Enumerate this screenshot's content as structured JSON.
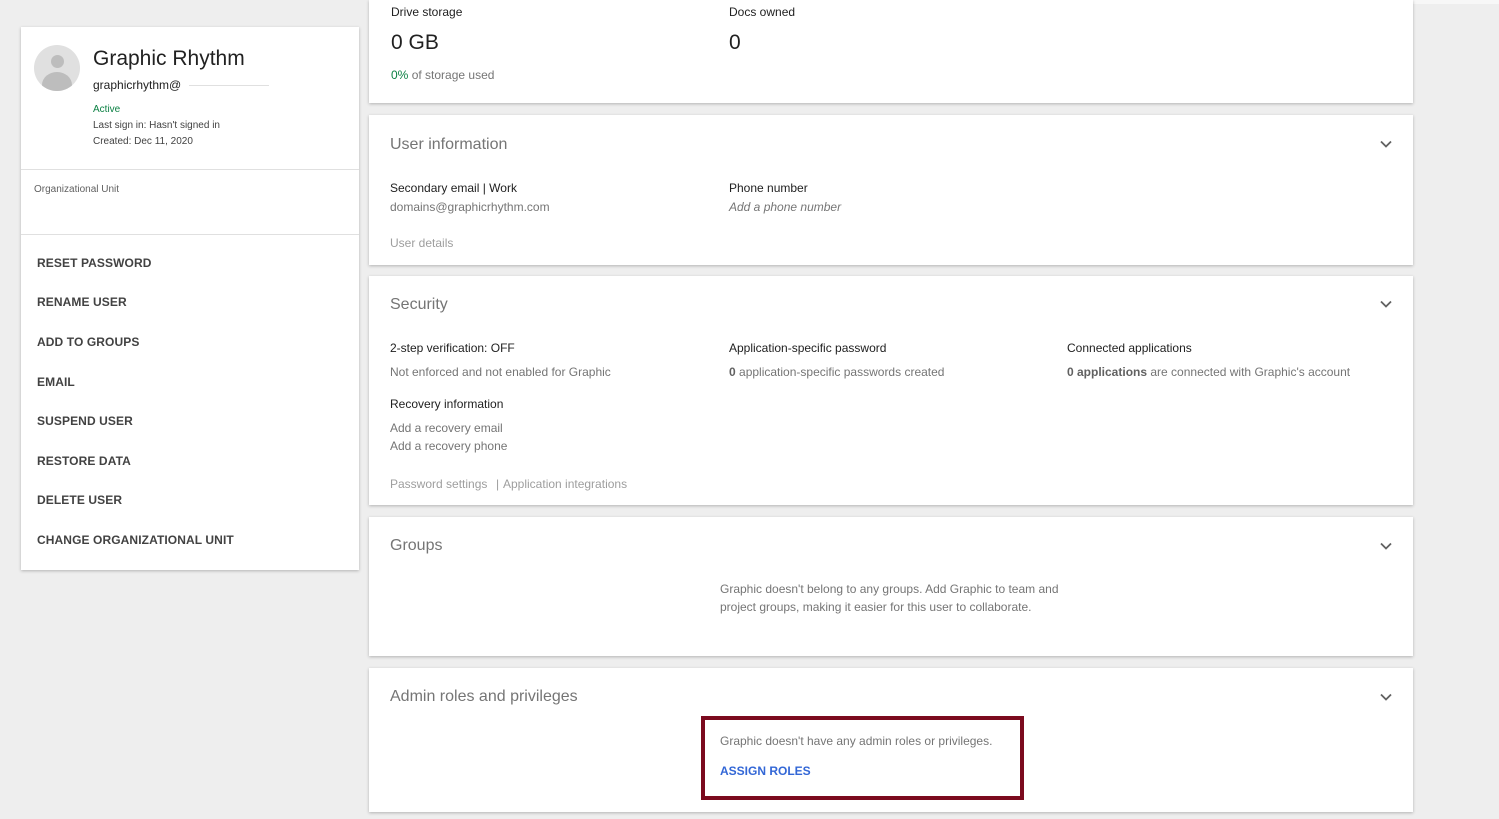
{
  "profile": {
    "name": "Graphic Rhythm",
    "email": "graphicrhythm@",
    "status": "Active",
    "last_sign_in": "Last sign in: Hasn't signed in",
    "created": "Created: Dec 11, 2020",
    "ou_label": "Organizational Unit"
  },
  "actions": [
    "RESET PASSWORD",
    "RENAME USER",
    "ADD TO GROUPS",
    "EMAIL",
    "SUSPEND USER",
    "RESTORE DATA",
    "DELETE USER",
    "CHANGE ORGANIZATIONAL UNIT"
  ],
  "storage": {
    "drive_label": "Drive storage",
    "drive_value": "0 GB",
    "used_pct": "0%",
    "used_suffix": "of storage used",
    "docs_label": "Docs owned",
    "docs_value": "0"
  },
  "user_info": {
    "title": "User information",
    "secondary_label": "Secondary email | Work",
    "secondary_value": "domains@graphicrhythm.com",
    "phone_label": "Phone number",
    "phone_placeholder": "Add a phone number",
    "details_link": "User details"
  },
  "security": {
    "title": "Security",
    "two_step_label": "2-step verification:",
    "two_step_value": "OFF",
    "two_step_desc": "Not enforced and not enabled for Graphic",
    "app_pw_label": "Application-specific password",
    "app_pw_count": "0",
    "app_pw_desc": "application-specific passwords created",
    "connected_label": "Connected applications",
    "connected_count": "0 applications",
    "connected_desc": "are connected with Graphic's account",
    "recovery_label": "Recovery information",
    "recovery_email": "Add a recovery email",
    "recovery_phone": "Add a recovery phone",
    "password_settings": "Password settings",
    "separator": "|",
    "app_integrations": "Application integrations"
  },
  "groups": {
    "title": "Groups",
    "message": "Graphic doesn't belong to any groups. Add Graphic to team and project groups, making it easier for this user to collaborate."
  },
  "admin": {
    "title": "Admin roles and privileges",
    "message": "Graphic doesn't have any admin roles or privileges.",
    "assign_label": "ASSIGN ROLES"
  },
  "colors": {
    "accent_link": "#3367d6",
    "status_green": "#0b8043",
    "highlight_border": "#7b0a1e"
  },
  "icons": {
    "expand": "chevron-down-icon",
    "avatar": "person-avatar-icon"
  }
}
